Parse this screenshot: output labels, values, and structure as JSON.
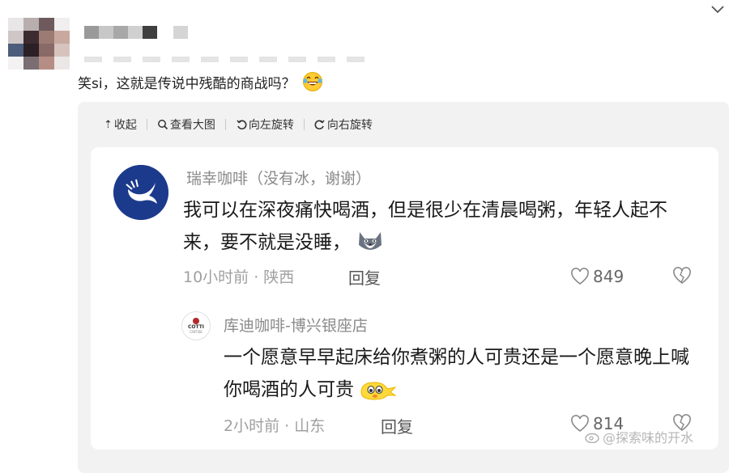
{
  "post": {
    "text": "笑si，这就是传说中残酷的商战吗？",
    "emoji": "laughing-tears-emoji"
  },
  "toolbar": {
    "collapse": "收起",
    "view_large": "查看大图",
    "rotate_left": "向左旋转",
    "rotate_right": "向右旋转"
  },
  "comment": {
    "author": "瑞幸咖啡（没有冰，谢谢）",
    "text": "我可以在深夜痛快喝酒，但是很少在清晨喝粥，年轻人起不来，要不就是没睡，",
    "time_location": "10小时前 · 陕西",
    "reply_label": "回复",
    "likes": "849"
  },
  "reply": {
    "author": "库迪咖啡-博兴银座店",
    "avatar_text": "COTTI",
    "avatar_sub": "COFFEE",
    "text": "一个愿意早早起床给你煮粥的人可贵还是一个愿意晚上喊你喝酒的人可贵",
    "time_location": "2小时前 · 山东",
    "reply_label": "回复",
    "likes": "814"
  },
  "watermark": "@探索味的开水",
  "colors": {
    "luckin_blue": "#1b3a8c",
    "cotti_red": "#b02a2a",
    "viewer_bg": "#f2f2f2"
  }
}
